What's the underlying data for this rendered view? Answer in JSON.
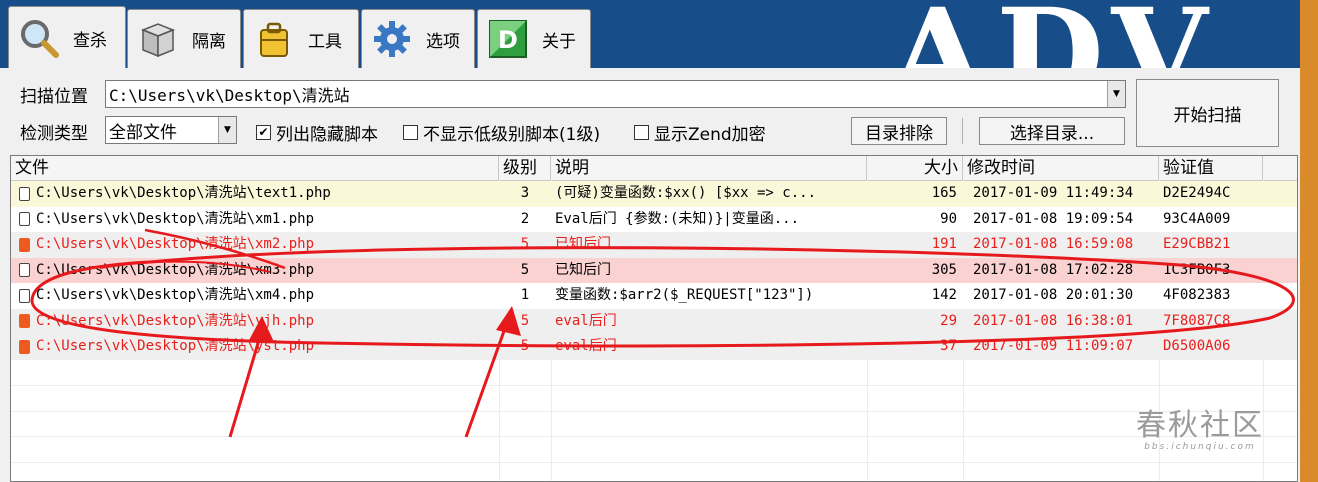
{
  "tabs": [
    {
      "label": "查杀",
      "icon": "magnifier-icon",
      "active": true
    },
    {
      "label": "隔离",
      "icon": "box-icon",
      "active": false
    },
    {
      "label": "工具",
      "icon": "toolbox-icon",
      "active": false
    },
    {
      "label": "选项",
      "icon": "gear-icon",
      "active": false
    },
    {
      "label": "关于",
      "icon": "d-logo-icon",
      "active": false
    }
  ],
  "brand_text": "ADV",
  "scan": {
    "location_label": "扫描位置",
    "location_value": "C:\\Users\\vk\\Desktop\\清洗站",
    "type_label": "检测类型",
    "type_value": "全部文件",
    "chk_hidden": {
      "label": "列出隐藏脚本",
      "checked": true
    },
    "chk_lowlevel": {
      "label": "不显示低级别脚本(1级)",
      "checked": false
    },
    "chk_zend": {
      "label": "显示Zend加密",
      "checked": false
    },
    "exclude_button": "目录排除",
    "select_dir_button": "选择目录...",
    "start_button": "开始扫描"
  },
  "columns": {
    "file": "文件",
    "level": "级别",
    "desc": "说明",
    "size": "大小",
    "time": "修改时间",
    "hash": "验证值"
  },
  "rows": [
    {
      "file": "C:\\Users\\vk\\Desktop\\清洗站\\text1.php",
      "level": "3",
      "desc": "(可疑)变量函数:$xx() [$xx => c...",
      "size": "165",
      "time": "2017-01-09 11:49:34",
      "hash": "D2E2494C",
      "color": "#000000",
      "bg": "#fbf8da",
      "icon": "red-false"
    },
    {
      "file": "C:\\Users\\vk\\Desktop\\清洗站\\xm1.php",
      "level": "2",
      "desc": "Eval后门 {参数:(未知)}|变量函...",
      "size": "90",
      "time": "2017-01-08 19:09:54",
      "hash": "93C4A009",
      "color": "#000000",
      "bg": "#ffffff",
      "icon": "red-false"
    },
    {
      "file": "C:\\Users\\vk\\Desktop\\清洗站\\xm2.php",
      "level": "5",
      "desc": "已知后门",
      "size": "191",
      "time": "2017-01-08 16:59:08",
      "hash": "E29CBB21",
      "color": "#e8201c",
      "bg": "#efefef",
      "icon": "red-true"
    },
    {
      "file": "C:\\Users\\vk\\Desktop\\清洗站\\xm3.php",
      "level": "5",
      "desc": "已知后门",
      "size": "305",
      "time": "2017-01-08 17:02:28",
      "hash": "1C3FB0F3",
      "color": "#000000",
      "bg": "#fad2d2",
      "icon": "red-false"
    },
    {
      "file": "C:\\Users\\vk\\Desktop\\清洗站\\xm4.php",
      "level": "1",
      "desc": "变量函数:$arr2($_REQUEST[\"123\"])",
      "size": "142",
      "time": "2017-01-08 20:01:30",
      "hash": "4F082383",
      "color": "#000000",
      "bg": "#ffffff",
      "icon": "red-false"
    },
    {
      "file": "C:\\Users\\vk\\Desktop\\清洗站\\yjh.php",
      "level": "5",
      "desc": "eval后门",
      "size": "29",
      "time": "2017-01-08 16:38:01",
      "hash": "7F8087C8",
      "color": "#e8201c",
      "bg": "#efefef",
      "icon": "red-true"
    },
    {
      "file": "C:\\Users\\vk\\Desktop\\清洗站\\yst.php",
      "level": "5",
      "desc": "eval后门",
      "size": "37",
      "time": "2017-01-09 11:09:07",
      "hash": "D6500A06",
      "color": "#e8201c",
      "bg": "#efefef",
      "icon": "red-true"
    }
  ],
  "watermark": {
    "big": "春秋社区",
    "small": "bbs.ichunqiu.com"
  },
  "colors": {
    "tabbar": "#174e8a",
    "annotation": "#e6191c",
    "danger_text": "#e8201c"
  }
}
